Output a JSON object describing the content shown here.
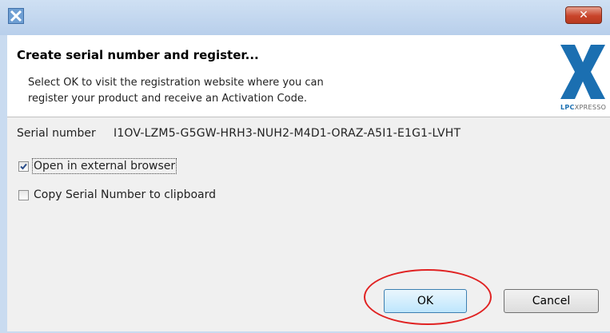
{
  "window": {
    "app_icon": "lpcxpresso-app-icon",
    "close_label": "✕"
  },
  "header": {
    "title": "Create serial number and register...",
    "message_line1": "Select OK to visit the registration website where you can",
    "message_line2": "register your product and receive an Activation Code.",
    "logo_text_bold": "LPC",
    "logo_text_rest": "XPRESSO"
  },
  "serial": {
    "label": "Serial number",
    "value": "I1OV-LZM5-G5GW-HRH3-NUH2-M4D1-ORAZ-A5I1-E1G1-LVHT"
  },
  "options": [
    {
      "label": "Open in external browser",
      "checked": true
    },
    {
      "label": "Copy Serial Number to clipboard",
      "checked": false
    }
  ],
  "buttons": {
    "ok": "OK",
    "cancel": "Cancel"
  },
  "colors": {
    "annotation": "#e02222",
    "logo": "#1b6fb1"
  }
}
